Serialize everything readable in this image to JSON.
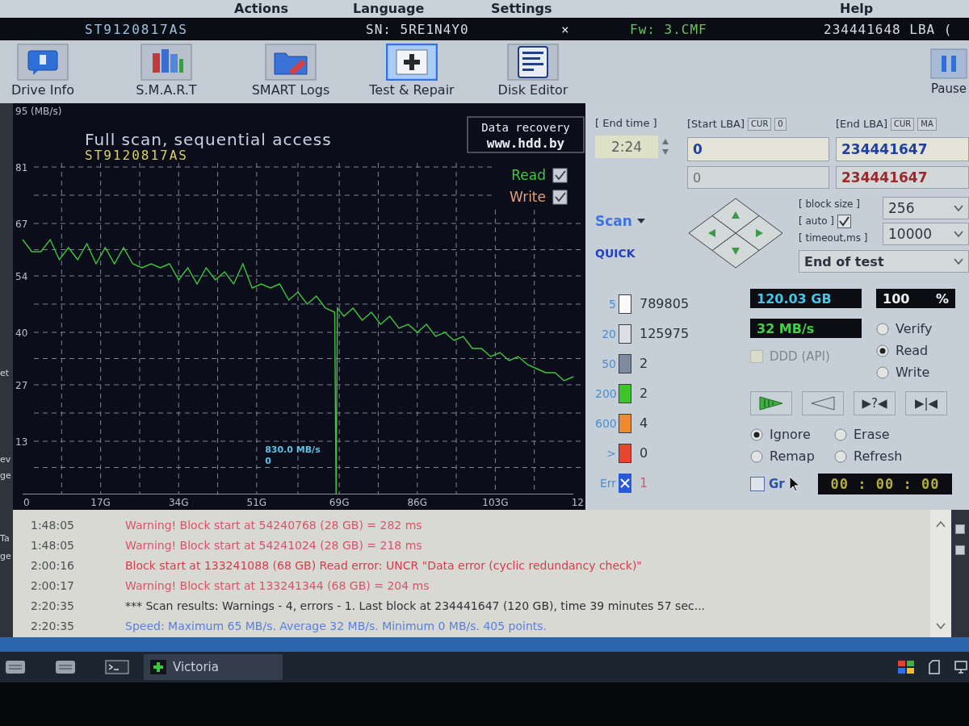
{
  "menu": [
    {
      "label": "Actions"
    },
    {
      "label": "Language"
    },
    {
      "label": "Settings"
    },
    {
      "label": "Help"
    }
  ],
  "info_bar": {
    "model": "ST9120817AS",
    "serial": "SN: 5RE1N4Y0",
    "close": "×",
    "firmware": "Fw: 3.CMF",
    "capacity": "234441648 LBA ("
  },
  "toolbar": [
    {
      "label": "Drive Info",
      "kind": "info",
      "selected": false
    },
    {
      "label": "S.M.A.R.T",
      "kind": "smart",
      "selected": false
    },
    {
      "label": "SMART Logs",
      "kind": "logs",
      "selected": false
    },
    {
      "label": "Test & Repair",
      "kind": "test",
      "selected": true
    },
    {
      "label": "Disk Editor",
      "kind": "editor",
      "selected": false
    }
  ],
  "pause": {
    "label": "Pause"
  },
  "side_window": {
    "fragments": [
      "et",
      "ev",
      "ge",
      "Ta",
      "ge"
    ]
  },
  "chart": {
    "subtitle": "ST9120817AS",
    "badge": [
      "Data recovery",
      "www.hdd.by"
    ],
    "legend": [
      {
        "checked": true
      },
      {
        "label": "Write",
        "checked": true,
        "color": "#e0a07c"
      }
    ],
    "cut_axis_label": "12",
    "chart_data": {
      "type": "line",
      "title": "Full scan, sequential access",
      "x": [
        0,
        2,
        4,
        6,
        8,
        10,
        12,
        14,
        16,
        18,
        20,
        22,
        24,
        26,
        28,
        30,
        32,
        34,
        36,
        38,
        40,
        42,
        44,
        46,
        48,
        50,
        52,
        54,
        56,
        58,
        60,
        62,
        64,
        66,
        68,
        68.3,
        68.6,
        70,
        72,
        74,
        76,
        78,
        80,
        82,
        84,
        86,
        88,
        90,
        92,
        94,
        96,
        98,
        100,
        102,
        104,
        106,
        108,
        110,
        112,
        114,
        116,
        118,
        120
      ],
      "series": [
        {
          "name": "Read",
          "color": "#3cc83c",
          "values": [
            63,
            60,
            60,
            63,
            58,
            61,
            58,
            62,
            57,
            61,
            57,
            61,
            57,
            56,
            57,
            56,
            57,
            53,
            56,
            52,
            56,
            53,
            55,
            52,
            57,
            51,
            52,
            51,
            52,
            48,
            50,
            47,
            49,
            46,
            45,
            0,
            46,
            44,
            46,
            43,
            45,
            42,
            44,
            41,
            42,
            40,
            42,
            39,
            40,
            38,
            39,
            36,
            36,
            34,
            35,
            33,
            34,
            32,
            31,
            30,
            30,
            28,
            29
          ]
        }
      ],
      "xlim": [
        0,
        120
      ],
      "ylim": [
        0,
        95
      ],
      "grid": true,
      "xticks": [
        {
          "value": 0,
          "label": "0"
        },
        {
          "value": 17,
          "label": "17G"
        },
        {
          "value": 34,
          "label": "34G"
        },
        {
          "value": 51,
          "label": "51G"
        },
        {
          "value": 69,
          "label": "69G"
        },
        {
          "value": 86,
          "label": "86G"
        },
        {
          "value": 103,
          "label": "103G"
        }
      ],
      "yticks": [
        13,
        27,
        40,
        54,
        67,
        81,
        {
          "value": 95,
          "label": "95 (MB/s)"
        }
      ],
      "annotations": [
        "830.0 MB/s",
        "0"
      ]
    }
  },
  "test_range": {
    "end_time": {
      "label": "[ End time ]",
      "value": "2:24"
    },
    "start_lba": {
      "label": "[Start LBA]",
      "buttons": [
        "CUR",
        "0"
      ],
      "value": "0",
      "current": "0"
    },
    "end_lba": {
      "label": "[End LBA]",
      "buttons": [
        "CUR",
        "MA"
      ],
      "value": "234441647",
      "current": "234441647"
    }
  },
  "scan": {
    "mode": "Scan",
    "quick": "QUICK"
  },
  "block_settings": {
    "block_size_label": "[ block size ]",
    "auto_label": "[ auto ]",
    "auto_checked": true,
    "timeout_label": "[ timeout,ms ]",
    "block_size": "256",
    "timeout": "10000",
    "end_action": "End of test"
  },
  "block_stats": [
    {
      "label": "5",
      "kind": "block",
      "color": "#fafafa",
      "count": "789805"
    },
    {
      "label": "20",
      "kind": "block",
      "color": "#dcdfe3",
      "count": "125975"
    },
    {
      "label": "50",
      "kind": "block",
      "color": "#7d8aa0",
      "count": "2"
    },
    {
      "label": "200",
      "kind": "block",
      "color": "#3cc428",
      "count": "2"
    },
    {
      "label": "600",
      "kind": "block",
      "color": "#f08a2c",
      "count": "4"
    },
    {
      "label": ">",
      "kind": "block",
      "color": "#e8452e",
      "count": "0"
    },
    {
      "label": "Err",
      "kind": "error",
      "color": "#2a5ad8",
      "count": "1"
    }
  ],
  "readouts": {
    "size": "120.03 GB",
    "percent": "100",
    "percent_unit": "%",
    "speed": "32 MB/s"
  },
  "ddd_api": {
    "label": "DDD (API)",
    "checked": false,
    "disabled": true
  },
  "test_mode": [
    {
      "label": "Verify",
      "selected": false
    },
    {
      "label": "Read",
      "selected": true
    },
    {
      "label": "Write",
      "selected": false
    }
  ],
  "transport": [
    {
      "kind": "play"
    },
    {
      "kind": "back"
    },
    {
      "kind": "text",
      "label": "▶?◀"
    },
    {
      "kind": "text",
      "label": "▶|◀"
    }
  ],
  "bad_block_action": [
    {
      "label": "Ignore",
      "selected": true
    },
    {
      "label": "Erase",
      "selected": false
    },
    {
      "label": "Remap",
      "selected": false
    },
    {
      "label": "Refresh",
      "selected": false
    }
  ],
  "grid": {
    "label": "Gr",
    "checked": false
  },
  "timer": "00 : 00 : 00",
  "log": [
    {
      "time": "1:48:05",
      "text": "Warning! Block start at 54240768 (28 GB) = 282 ms",
      "kind": "warning"
    },
    {
      "time": "1:48:05",
      "text": "Warning! Block start at 54241024 (28 GB) = 218 ms",
      "kind": "warning"
    },
    {
      "time": "2:00:16",
      "text": "Block start at 133241088 (68 GB) Read error: UNCR \"Data error (cyclic redundancy check)\"",
      "kind": "error"
    },
    {
      "time": "2:00:17",
      "text": "Warning! Block start at 133241344 (68 GB) = 204 ms",
      "kind": "warning"
    },
    {
      "time": "2:20:35",
      "text": "*** Scan results: Warnings - 4, errors - 1. Last block at 234441647 (120 GB), time 39 minutes 57 sec...",
      "kind": "result"
    },
    {
      "time": "2:20:35",
      "text": "Speed: Maximum 65 MB/s. Average 32 MB/s. Minimum 0 MB/s. 405 points.",
      "kind": "speed"
    }
  ],
  "taskbar": {
    "task": "Victoria"
  }
}
